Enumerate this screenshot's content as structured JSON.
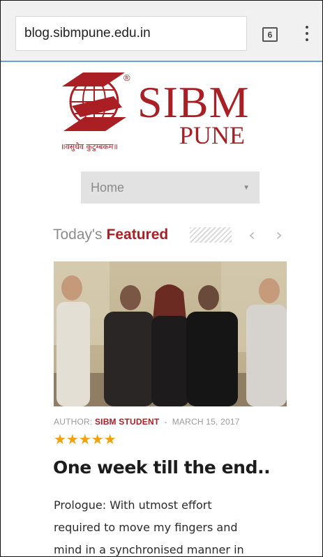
{
  "browser": {
    "url": "blog.sibmpune.edu.in",
    "tab_count": "6",
    "accent": "#6c9fe0"
  },
  "logo": {
    "name": "SIBM",
    "subname": "PUNE",
    "tagline": "॥वसुधैव कुटुम्बकम॥",
    "registered": "®",
    "color": "#a91f24"
  },
  "nav": {
    "selected": "Home"
  },
  "featured": {
    "prefix": "Today's",
    "highlight": "Featured",
    "prev_icon": "chevron-left-icon",
    "next_icon": "chevron-right-icon"
  },
  "post": {
    "author_label": "AUTHOR:",
    "author_name": "SIBM STUDENT",
    "separator": "-",
    "date": "MARCH 15, 2017",
    "rating": 5,
    "rating_stars": "★★★★★",
    "title": "One week till the end..",
    "excerpt_lines": [
      " Prologue: With utmost effort",
      "required to move my fingers and",
      "mind in a synchronised manner in"
    ]
  }
}
